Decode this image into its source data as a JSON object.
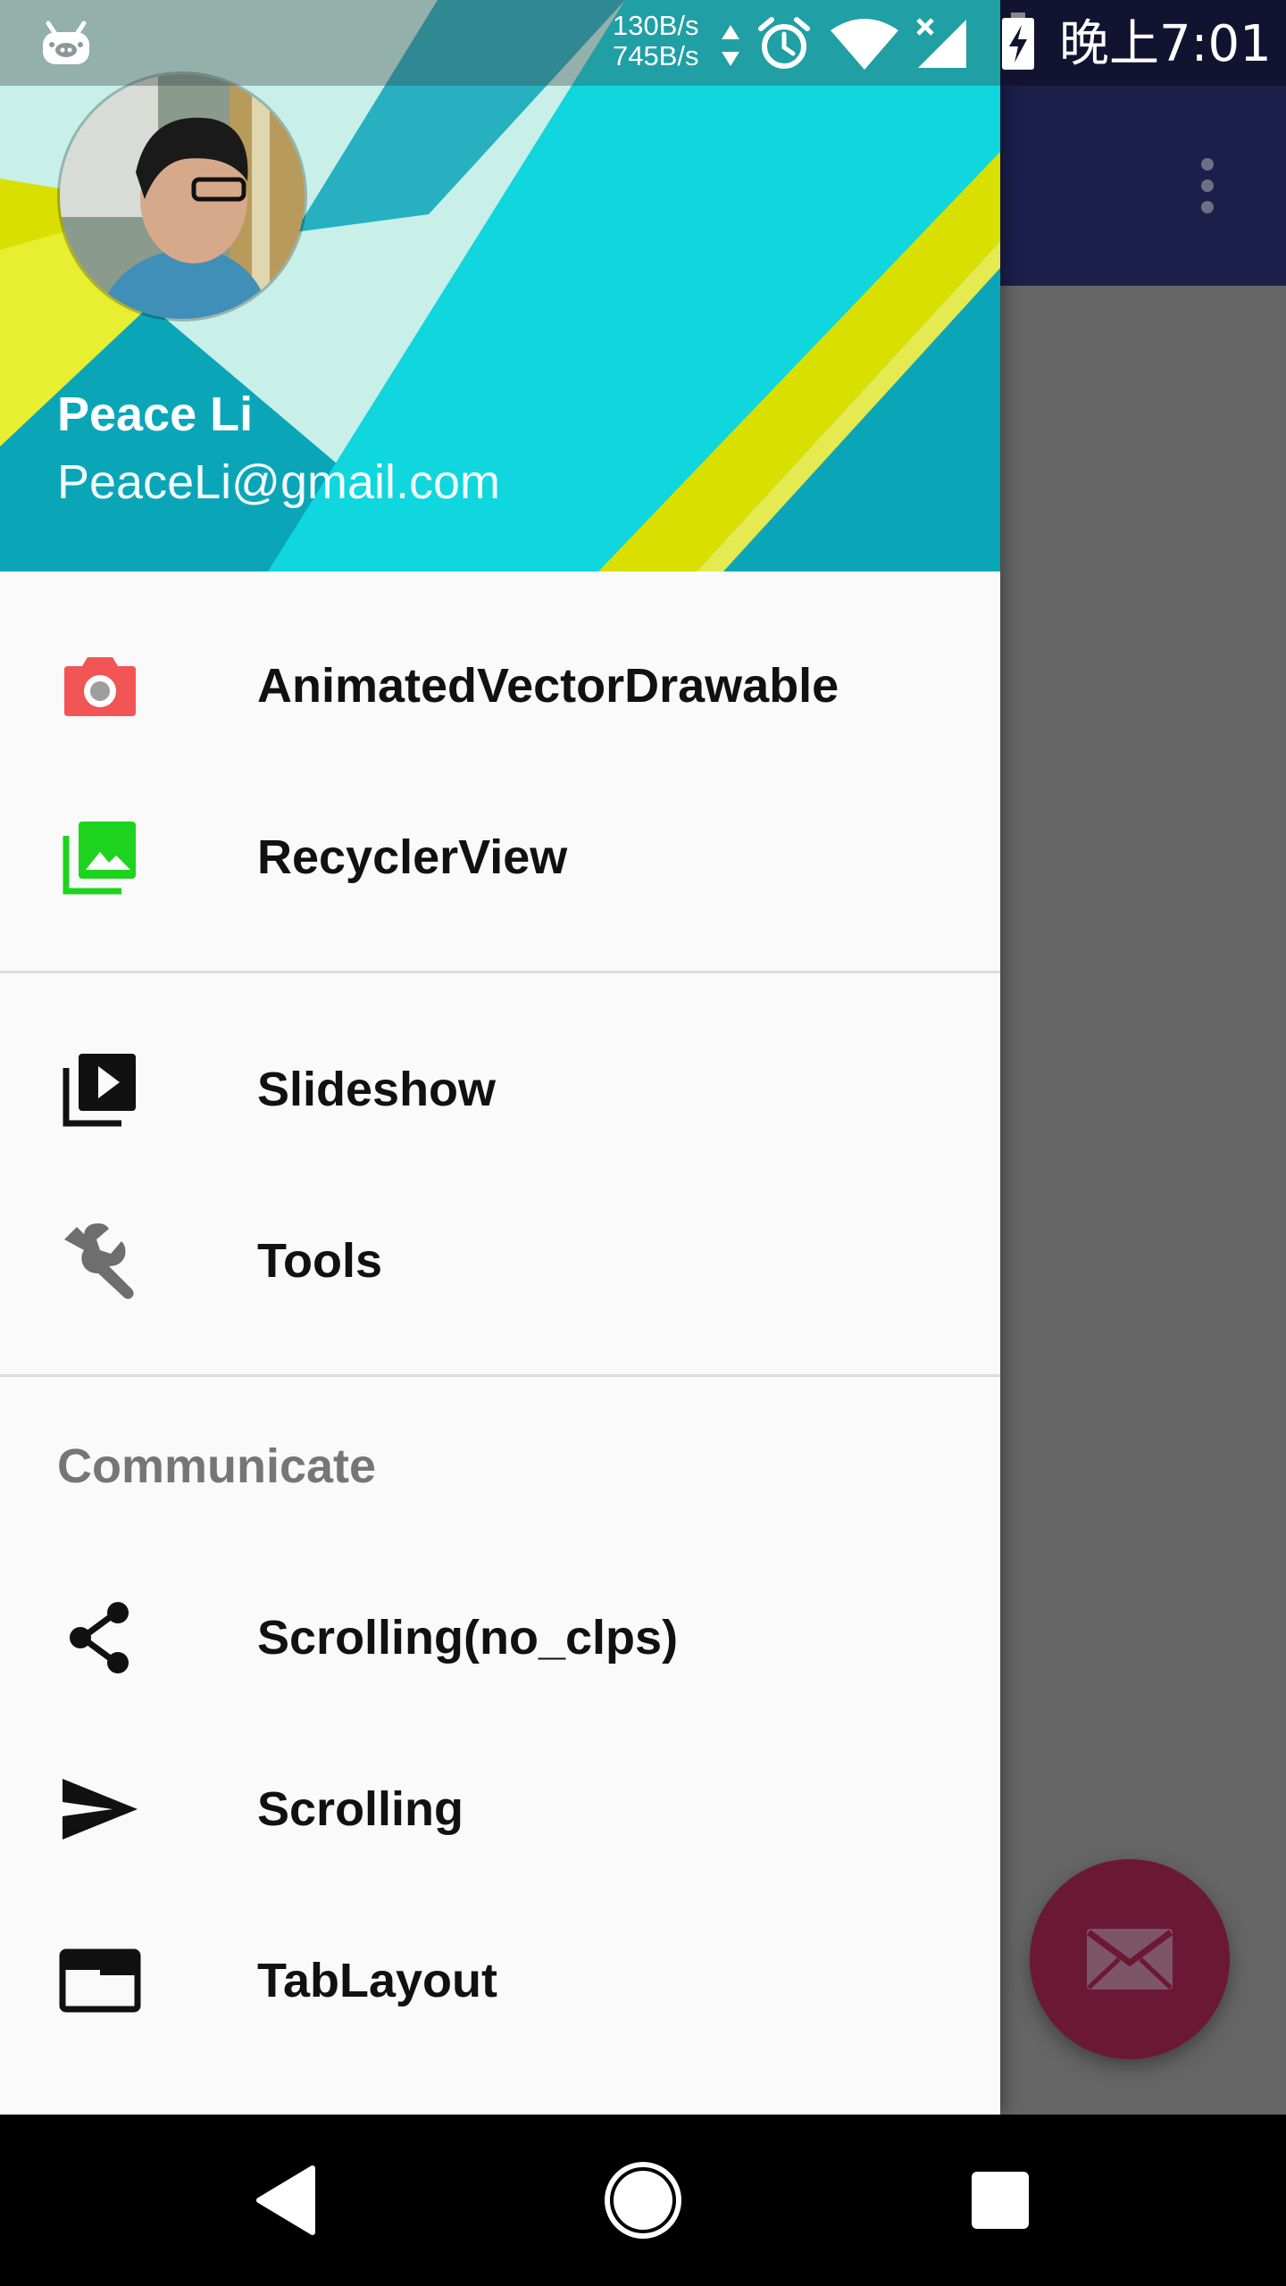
{
  "status_bar": {
    "net_speed_up": "130B/s",
    "net_speed_down": "745B/s",
    "time": "晚上7:01",
    "icons": [
      "notification-app-icon",
      "transfer-arrows-icon",
      "alarm-icon",
      "wifi-icon",
      "cell-signal-icon",
      "battery-charging-icon"
    ]
  },
  "drawer": {
    "header": {
      "user_name": "Peace Li",
      "user_email": "PeaceLi@gmail.com",
      "colors": {
        "teal": "#0aa6b8",
        "cyan": "#10d6dd",
        "mint": "#c8f0e9",
        "yellow": "#d9e000"
      }
    },
    "menu_groups": [
      {
        "items": [
          {
            "label": "AnimatedVectorDrawable",
            "icon": "camera-icon",
            "icon_color": "#f25555"
          },
          {
            "label": "RecyclerView",
            "icon": "gallery-icon",
            "icon_color": "#1ed31e"
          }
        ]
      },
      {
        "items": [
          {
            "label": "Slideshow",
            "icon": "slideshow-icon",
            "icon_color": "#111111"
          },
          {
            "label": "Tools",
            "icon": "wrench-icon",
            "icon_color": "#6e6e6e"
          }
        ]
      },
      {
        "title": "Communicate",
        "items": [
          {
            "label": "Scrolling(no_clps)",
            "icon": "share-icon",
            "icon_color": "#111111"
          },
          {
            "label": "Scrolling",
            "icon": "send-icon",
            "icon_color": "#111111"
          },
          {
            "label": "TabLayout",
            "icon": "tab-window-icon",
            "icon_color": "#111111"
          }
        ]
      }
    ]
  },
  "app": {
    "toolbar_color": "#1b1f4a",
    "fab": {
      "icon": "mail-icon",
      "color": "#6b1834"
    }
  },
  "nav_bar": {
    "buttons": [
      "back-icon",
      "home-icon",
      "recents-icon"
    ]
  }
}
